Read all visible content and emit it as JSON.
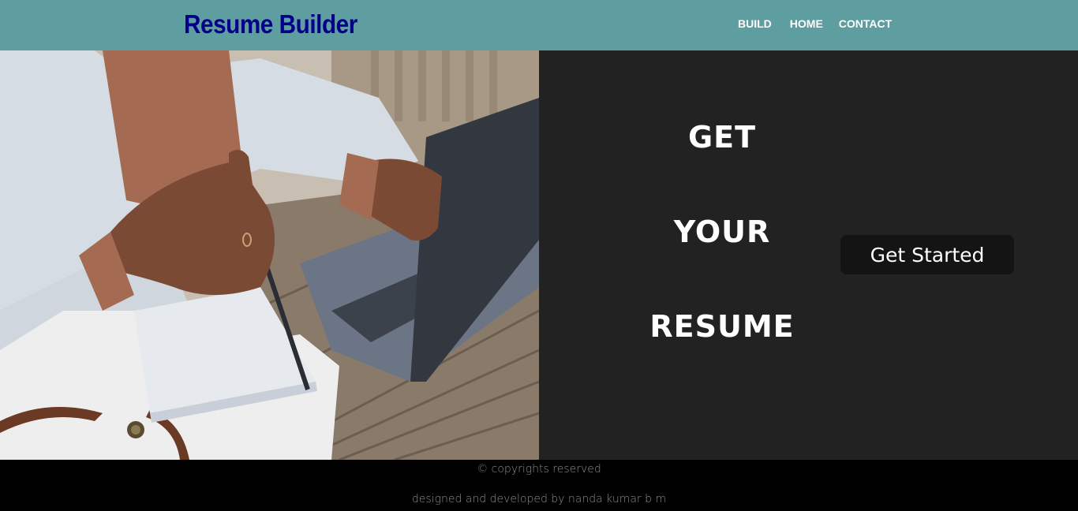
{
  "navbar": {
    "brand": "Resume Builder",
    "links": [
      "BUILD",
      "HOME",
      "CONTACT"
    ]
  },
  "hero": {
    "photo_alt": "person holding notebook beside laptop",
    "headline": [
      "GET",
      "YOUR",
      "RESUME"
    ],
    "cta_label": "Get Started"
  },
  "footer": {
    "copyright": "© copyrights reserved",
    "credit": "designed and developed by nanda kumar b m"
  },
  "colors": {
    "navbar_bg": "#5f9ea0",
    "brand_text": "#00008b",
    "panel_bg": "#222222",
    "footer_bg": "#000000"
  }
}
